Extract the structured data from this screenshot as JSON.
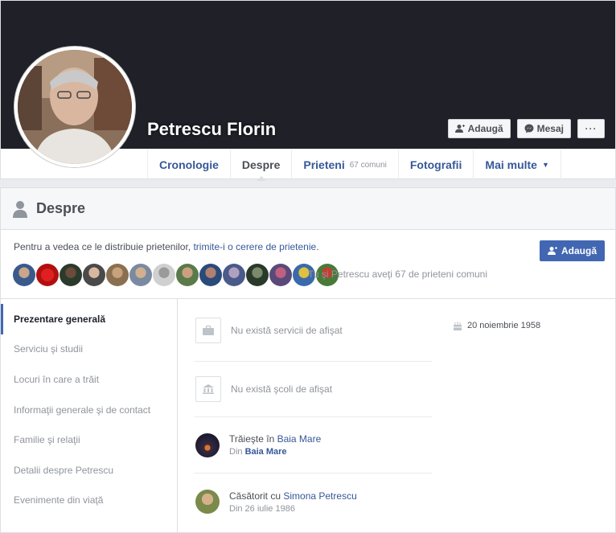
{
  "profile": {
    "name": "Petrescu Florin"
  },
  "cover_buttons": {
    "add_label": "Adaugă",
    "message_label": "Mesaj",
    "more_label": "···"
  },
  "tabs": [
    {
      "label": "Cronologie"
    },
    {
      "label": "Despre"
    },
    {
      "label": "Prieteni",
      "sub": "67 comuni"
    },
    {
      "label": "Fotografii"
    },
    {
      "label": "Mai multe",
      "caret": "▼"
    }
  ],
  "about": {
    "title": "Despre",
    "request_prefix": "Pentru a vedea ce le distribuie prietenilor, ",
    "request_link": "trimite-i o cerere de prietenie",
    "request_suffix": ".",
    "add_button": "Adaugă",
    "mutual_text": "Tu şi Petrescu aveţi 67 de prieteni comuni"
  },
  "side_nav": [
    {
      "label": "Prezentare generală"
    },
    {
      "label": "Serviciu şi studii"
    },
    {
      "label": "Locuri în care a trăit"
    },
    {
      "label": "Informaţii generale şi de contact"
    },
    {
      "label": "Familie şi relaţii"
    },
    {
      "label": "Detalii despre Petrescu"
    },
    {
      "label": "Evenimente din viaţă"
    }
  ],
  "overview": {
    "work_empty": "Nu există servicii de afişat",
    "school_empty": "Nu există şcoli de afişat",
    "lives_prefix": "Trăieşte în ",
    "lives_city": "Baia Mare",
    "lives_from_prefix": "Din ",
    "lives_from_city": "Baia Mare",
    "married_prefix": "Căsătorit cu ",
    "married_name": "Simona Petrescu",
    "married_since": "Din 26 iulie 1986",
    "birthday": "20 noiembrie 1958"
  },
  "colors": {
    "link": "#365899",
    "accent": "#4267b2",
    "cover": "#1f2028",
    "muted": "#90949c"
  }
}
